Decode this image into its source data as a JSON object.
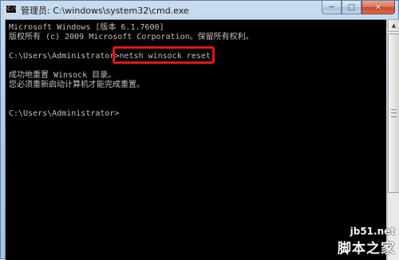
{
  "window": {
    "title": "管理员: C:\\windows\\system32\\cmd.exe",
    "icon": "cmd-icon",
    "icon_glyph": "C:\\",
    "controls": {
      "minimize": "─",
      "maximize": "□",
      "close": "✕"
    }
  },
  "console": {
    "lines": [
      "Microsoft Windows [版本 6.1.7600]",
      "版权所有 (c) 2009 Microsoft Corporation。保留所有权利。",
      "",
      "C:\\Users\\Administrator>netsh winsock reset",
      "",
      "成功地重置 Winsock 目录。",
      "您必须重新启动计算机才能完成重置。",
      "",
      "",
      "C:\\Users\\Administrator>"
    ],
    "highlighted_command": "netsh winsock reset",
    "highlight_color": "#e01818",
    "text_color": "#c0c0c0",
    "background": "#000000"
  },
  "scrollbar": {
    "up_glyph": "▲"
  },
  "watermark": {
    "site": "jb51.net",
    "brand": "脚本之家"
  }
}
